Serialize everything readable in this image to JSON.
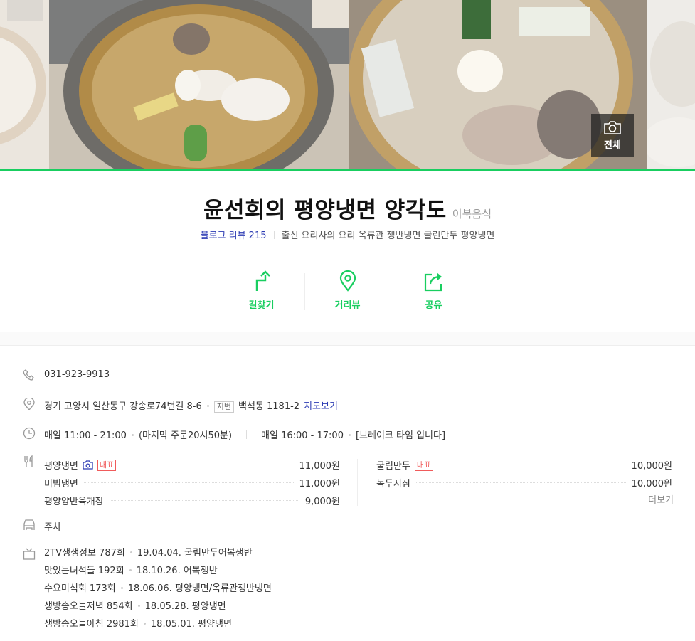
{
  "photos": {
    "all_label": "전체",
    "items": [
      "photo-1",
      "photo-2",
      "photo-3",
      "photo-4"
    ]
  },
  "place": {
    "name": "윤선희의 평양냉면 양각도",
    "category": "이북음식",
    "blog_review_label": "블로그 리뷰 215",
    "keywords": "출신 요리사의 요리 옥류관 쟁반냉면 굴린만두 평양냉면"
  },
  "actions": [
    {
      "label": "길찾기",
      "icon": "directions-icon"
    },
    {
      "label": "거리뷰",
      "icon": "street-view-icon"
    },
    {
      "label": "공유",
      "icon": "share-icon"
    }
  ],
  "info": {
    "phone": "031-923-9913",
    "address": "경기 고양시 일산동구 강송로74번길 8-6",
    "lot_tag": "지번",
    "lot_address": "백석동 1181-2",
    "map_link": "지도보기",
    "hours_1": "매일 11:00 - 21:00",
    "hours_1_note": "(마지막 주문20시50분)",
    "hours_2": "매일 16:00 - 17:00",
    "hours_2_note": "[브레이크 타임 입니다]",
    "parking": "주차"
  },
  "menu": {
    "rep_tag": "대표",
    "more_label": "더보기",
    "left": [
      {
        "name": "평양냉면",
        "price": "11,000원"
      },
      {
        "name": "비빔냉면",
        "price": "11,000원"
      },
      {
        "name": "평양양반육개장",
        "price": "9,000원"
      }
    ],
    "right": [
      {
        "name": "굴림만두",
        "price": "10,000원"
      },
      {
        "name": "녹두지짐",
        "price": "10,000원"
      }
    ]
  },
  "tv": [
    {
      "show": "2TV생생정보 787회",
      "desc": "19.04.04. 굴림만두어복쟁반"
    },
    {
      "show": "맛있는녀석들 192회",
      "desc": "18.10.26. 어복쟁반"
    },
    {
      "show": "수요미식회 173회",
      "desc": "18.06.06. 평양냉면/옥류관쟁반냉면"
    },
    {
      "show": "생방송오늘저녁 854회",
      "desc": "18.05.28. 평양냉면"
    },
    {
      "show": "생방송오늘아침 2981회",
      "desc": "18.05.01. 평양냉면"
    }
  ],
  "colors": {
    "accent": "#19ce60",
    "link": "#2b3ab3",
    "rep": "#f05b5b"
  }
}
